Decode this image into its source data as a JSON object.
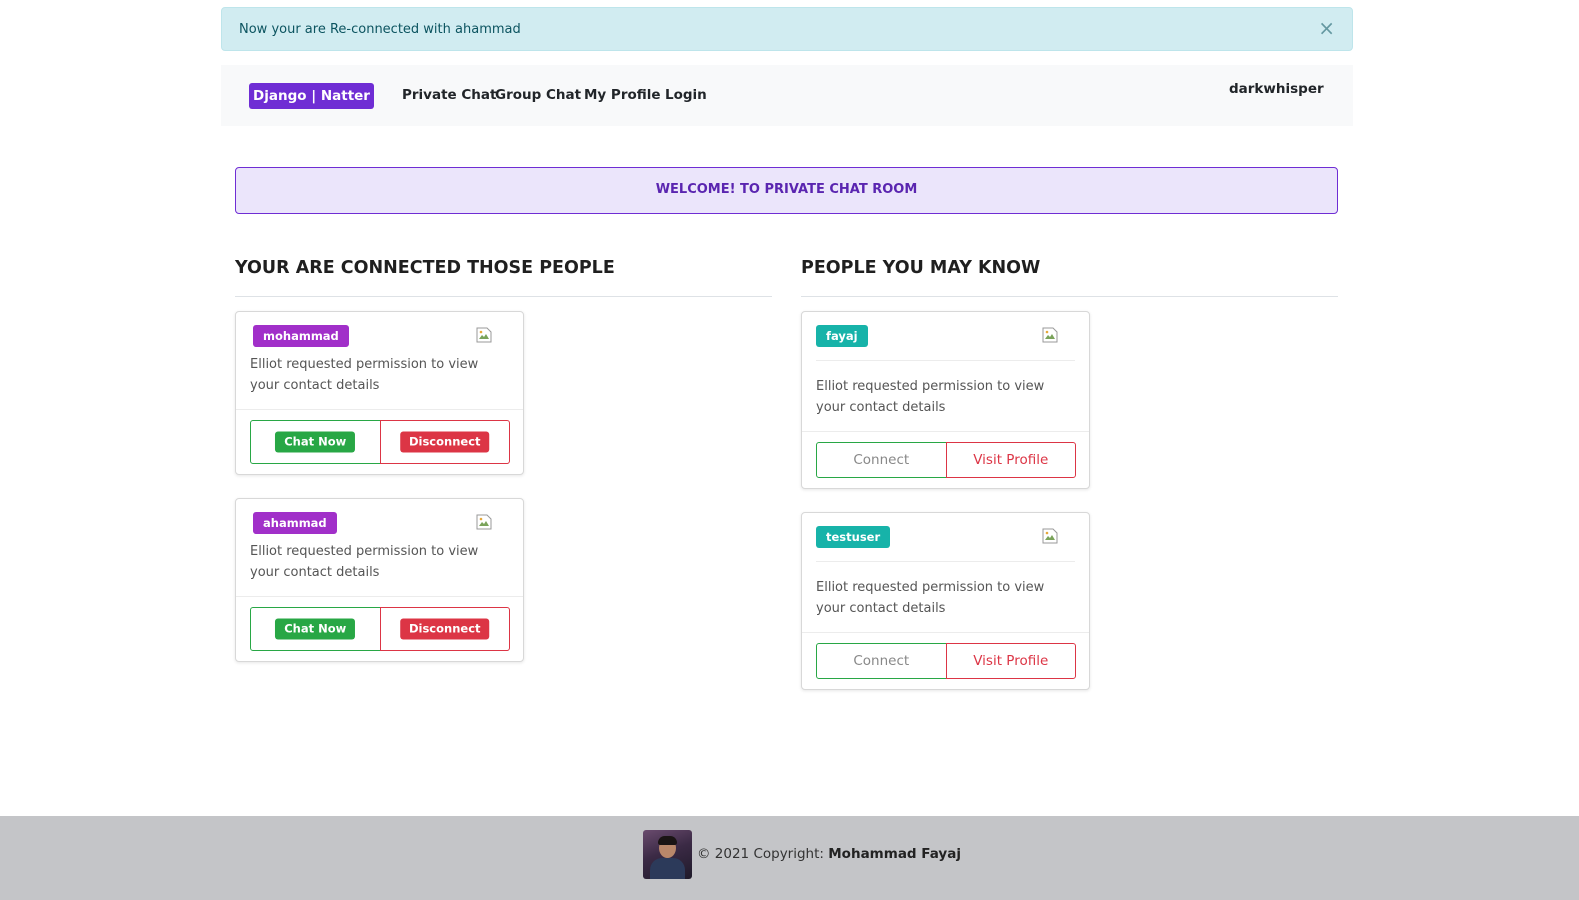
{
  "alert": {
    "message": "Now your are Re-connected with ahammad",
    "close_symbol": "×"
  },
  "navbar": {
    "brand": "Django | Natter",
    "links": [
      "Private Chat",
      "Group Chat",
      "My Profile",
      "Login"
    ],
    "username": "darkwhisper"
  },
  "welcome": "WELCOME! TO PRIVATE CHAT ROOM",
  "connected": {
    "title": "YOUR ARE CONNECTED THOSE PEOPLE",
    "people": [
      {
        "name": "mohammad",
        "description": "Elliot requested permission to view your contact details",
        "chat_label": "Chat Now",
        "disconnect_label": "Disconnect"
      },
      {
        "name": "ahammad",
        "description": "Elliot requested permission to view your contact details",
        "chat_label": "Chat Now",
        "disconnect_label": "Disconnect"
      }
    ]
  },
  "suggestions": {
    "title": "PEOPLE YOU MAY KNOW",
    "people": [
      {
        "name": "fayaj",
        "description": "Elliot requested permission to view your contact details",
        "connect_label": "Connect",
        "visit_label": "Visit Profile"
      },
      {
        "name": "testuser",
        "description": "Elliot requested permission to view your contact details",
        "connect_label": "Connect",
        "visit_label": "Visit Profile"
      }
    ]
  },
  "footer": {
    "copyright_prefix": "© 2021 Copyright:",
    "author": "Mohammad Fayaj"
  },
  "colors": {
    "brand": "#6f2dd4",
    "badge_connected": "#a12fc9",
    "badge_suggested": "#17b3a9",
    "success": "#28a745",
    "danger": "#dc3545"
  }
}
